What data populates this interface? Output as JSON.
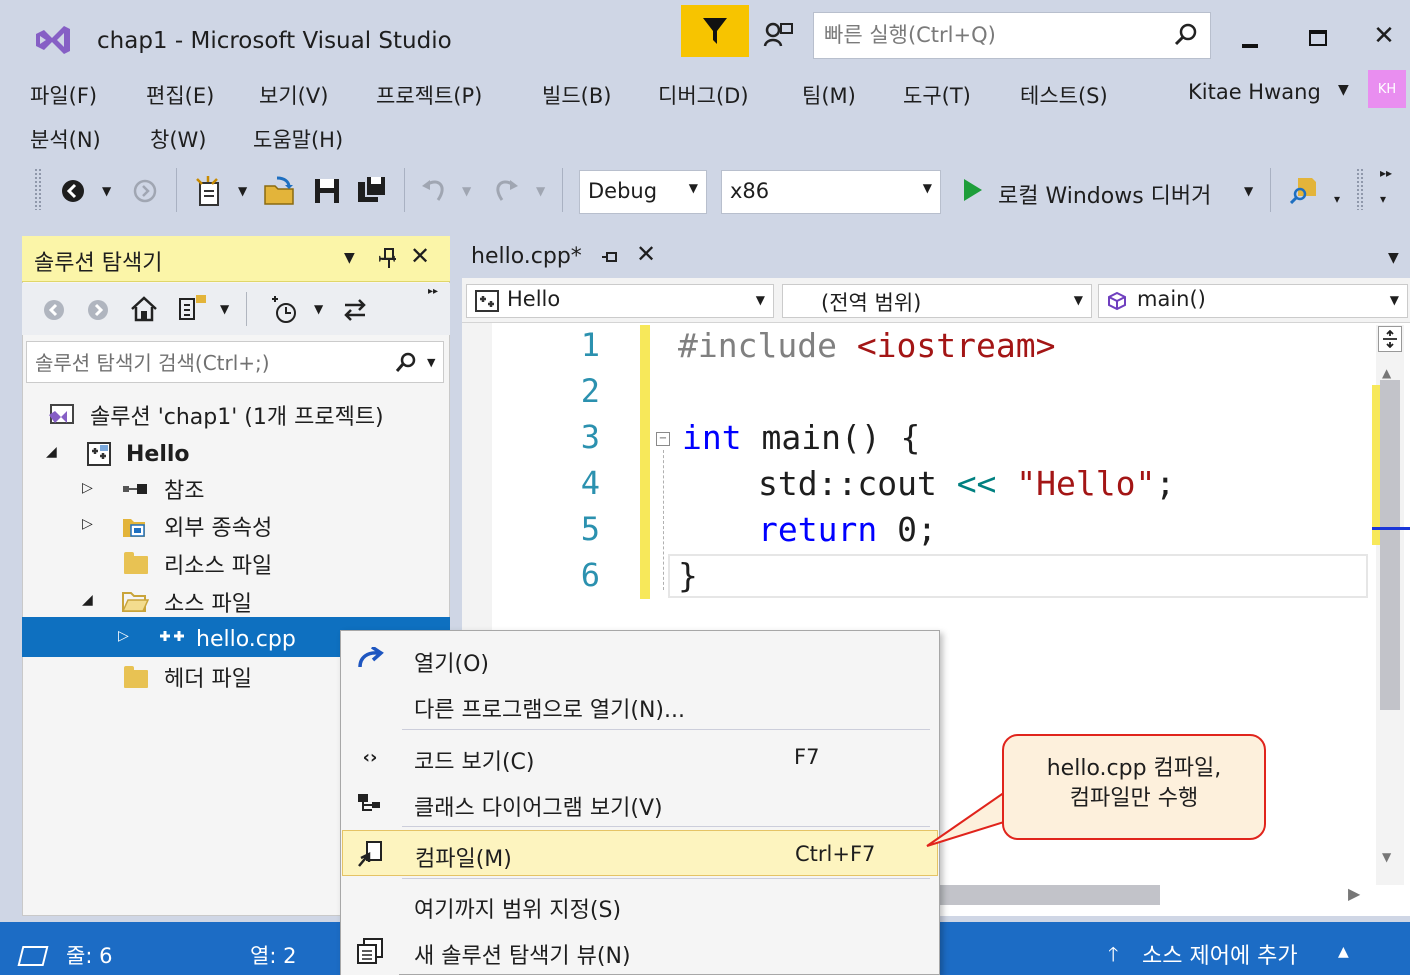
{
  "window": {
    "title": "chap1 - Microsoft Visual Studio",
    "quick_launch_placeholder": "빠른 실행(Ctrl+Q)"
  },
  "menu": {
    "items": [
      "파일(F)",
      "편집(E)",
      "보기(V)",
      "프로젝트(P)",
      "빌드(B)",
      "디버그(D)",
      "팀(M)",
      "도구(T)",
      "테스트(S)",
      "분석(N)",
      "창(W)",
      "도움말(H)"
    ],
    "user_name": "Kitae Hwang",
    "avatar_initials": "KH"
  },
  "toolbar": {
    "configuration": "Debug",
    "platform": "x86",
    "run_target": "로컬 Windows 디버거"
  },
  "solution_explorer": {
    "title": "솔루션 탐색기",
    "search_placeholder": "솔루션 탐색기 검색(Ctrl+;)",
    "solution_label": "솔루션 'chap1' (1개 프로젝트)",
    "project_label": "Hello",
    "nodes": [
      "참조",
      "외부 종속성",
      "리소스 파일",
      "소스 파일",
      "hello.cpp",
      "헤더 파일"
    ]
  },
  "editor": {
    "tab_title": "hello.cpp*",
    "nav_project": "Hello",
    "nav_scope": "(전역 범위)",
    "nav_member": "main()",
    "line_numbers": [
      "1",
      "2",
      "3",
      "4",
      "5",
      "6"
    ],
    "code": {
      "line1_pp": "#include ",
      "line1_str": "<iostream>",
      "line3_kw": "int",
      "line3_rest": " main() {",
      "line4_a": "std::cout ",
      "line4_op": "<<",
      "line4_str": " \"Hello\"",
      "line4_end": ";",
      "line5_kw": "return",
      "line5_rest": " 0;",
      "line6": "}"
    }
  },
  "context_menu": {
    "items": [
      {
        "label": "열기(O)",
        "shortcut": ""
      },
      {
        "label": "다른 프로그램으로 열기(N)...",
        "shortcut": ""
      },
      {
        "label": "코드 보기(C)",
        "shortcut": "F7"
      },
      {
        "label": "클래스 다이어그램 보기(V)",
        "shortcut": ""
      },
      {
        "label": "컴파일(M)",
        "shortcut": "Ctrl+F7"
      },
      {
        "label": "여기까지 범위 지정(S)",
        "shortcut": ""
      },
      {
        "label": "새 솔루션 탐색기 뷰(N)",
        "shortcut": ""
      }
    ],
    "highlighted_item": "컴파일(M)"
  },
  "callout": {
    "line1": "hello.cpp 컴파일,",
    "line2": "컴파일만 수행"
  },
  "statusbar": {
    "line": "줄: 6",
    "column": "열: 2",
    "source_control": "소스 제어에 추가"
  },
  "colors": {
    "accent": "#0e70c0",
    "statusbar": "#1c6cc5",
    "highlight": "#f7c400",
    "callout_border": "#e0241c"
  }
}
